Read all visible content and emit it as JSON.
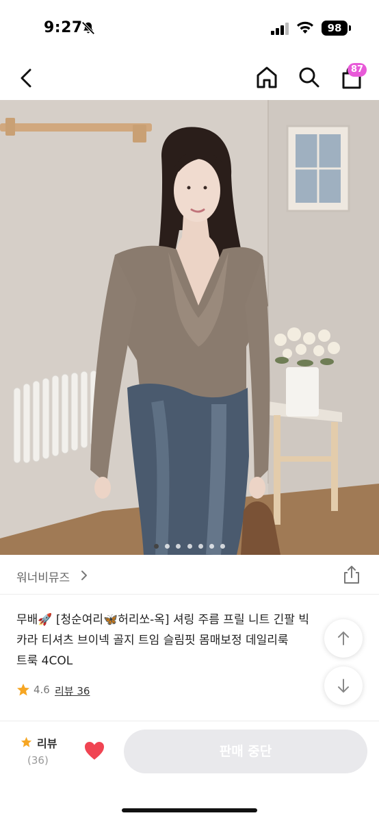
{
  "status_bar": {
    "time": "9:27",
    "battery": "98"
  },
  "nav": {
    "cart_badge": "87"
  },
  "carousel": {
    "dot_count": 7,
    "active_index": 0
  },
  "brand": {
    "name": "워너비뮤즈"
  },
  "product": {
    "title_line1": "무배🚀 [청순여리🦋허리쏘-옥] 셔링 주름 프릴 니트 긴팔 빅",
    "title_line2": "카라 티셔츠 브이넥 골지 트임 슬림핏 몸매보정 데일리룩",
    "title_line3": "트룩 4COL",
    "rating": "4.6",
    "review_link": "리뷰 36"
  },
  "bottom_bar": {
    "review_label": "리뷰",
    "review_count": "(36)",
    "button_label": "판매 중단"
  },
  "colors": {
    "badge": "#e85ad8",
    "star": "#f6a623",
    "heart": "#f04452",
    "button_bg": "#e9e9ec"
  }
}
